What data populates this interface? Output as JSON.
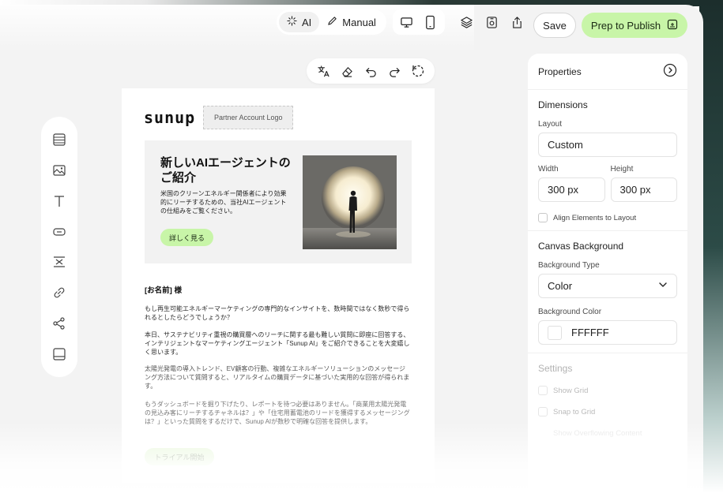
{
  "toolbar": {
    "ai_label": "AI",
    "manual_label": "Manual",
    "save_label": "Save",
    "publish_label": "Prep to Publish"
  },
  "canvas": {
    "brand": "sunup",
    "partner_logo": "Partner Account Logo",
    "hero_title": "新しいAIエージェントのご紹介",
    "hero_desc": "米国のクリーンエネルギー関係者により効果的にリーチするための、当社AIエージェントの仕組みをご覧ください。",
    "hero_button": "詳しく見る",
    "greeting": "[お名前] 様",
    "paragraphs": [
      "もし再生可能エネルギーマーケティングの専門的なインサイトを、数時間ではなく数秒で得られるとしたらどうでしょうか？",
      "本日、サステナビリティ重視の購買層へのリーチに関する最も難しい質問に即座に回答する、インテリジェントなマーケティングエージェント「Sunup AI」をご紹介できることを大変嬉しく思います。",
      "太陽光発電の導入トレンド、EV顧客の行動、複雑なエネルギーソリューションのメッセージング方法について質問すると、リアルタイムの購買データに基づいた実用的な回答が得られます。",
      "もうダッシュボードを掘り下げたり、レポートを待つ必要はありません。「商業用太陽光発電の見込み客にリーチするチャネルは？」や「住宅用蓄電池のリードを獲得するメッセージングは？」といった質問をするだけで、Sunup AIが数秒で明確な回答を提供します。"
    ],
    "trial_button": "トライアル開始"
  },
  "panel": {
    "title": "Properties",
    "dimensions_title": "Dimensions",
    "layout_label": "Layout",
    "layout_value": "Custom",
    "width_label": "Width",
    "width_value": "300 px",
    "height_label": "Height",
    "height_value": "300 px",
    "align_label": "Align Elements to Layout",
    "canvas_bg_title": "Canvas Background",
    "bg_type_label": "Background Type",
    "bg_type_value": "Color",
    "bg_color_label": "Background Color",
    "bg_color_value": "FFFFFF",
    "settings_title": "Settings",
    "show_grid": "Show Grid",
    "snap_grid": "Snap to Grid",
    "hidden_option": "Show Overflowing Content"
  },
  "colors": {
    "accent_green": "#c8f5a8",
    "panel_bg": "#ffffff",
    "app_bg": "#f3f3f3"
  },
  "icons": {
    "sidebar": [
      "layout-icon",
      "image-icon",
      "text-icon",
      "button-icon",
      "spacer-icon",
      "link-icon",
      "share-icon",
      "footer-icon"
    ],
    "edit_toolbar": [
      "translate-icon",
      "eraser-icon",
      "undo-icon",
      "redo-icon",
      "reset-icon"
    ],
    "top_tools": [
      "desktop-icon",
      "mobile-icon",
      "layers-icon",
      "preview-icon",
      "export-icon"
    ]
  }
}
